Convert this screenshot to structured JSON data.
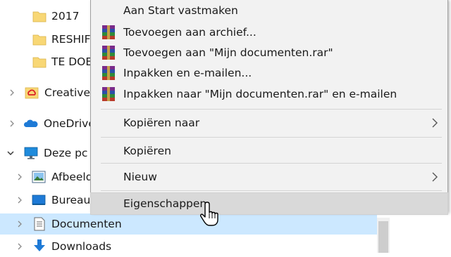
{
  "nav_pane": {
    "items": [
      {
        "label": "2017",
        "icon": "folder-icon"
      },
      {
        "label": "RESHIFT",
        "icon": "folder-icon"
      },
      {
        "label": "TE DOE",
        "icon": "folder-icon"
      },
      {
        "label": "Creative Cloud Files",
        "icon": "creative-cloud-icon"
      },
      {
        "label": "OneDrive",
        "icon": "onedrive-cloud-icon"
      },
      {
        "label": "Deze pc",
        "icon": "computer-icon"
      },
      {
        "label": "Afbeeldingen",
        "icon": "pictures-icon"
      },
      {
        "label": "Bureaublad",
        "icon": "desktop-icon"
      },
      {
        "label": "Documenten",
        "icon": "documents-icon",
        "selected": true
      },
      {
        "label": "Downloads",
        "icon": "download-arrow-icon"
      }
    ]
  },
  "context_menu": {
    "items": [
      {
        "label": "Aan Start vastmaken",
        "icon": null
      },
      {
        "label": "Toevoegen aan archief...",
        "icon": "winrar-icon"
      },
      {
        "label": "Toevoegen aan \"Mijn documenten.rar\"",
        "icon": "winrar-icon"
      },
      {
        "label": "Inpakken en e-mailen...",
        "icon": "winrar-icon"
      },
      {
        "label": "Inpakken naar \"Mijn documenten.rar\" en e-mailen",
        "icon": "winrar-icon"
      },
      {
        "label": "Kopiëren naar",
        "submenu": true
      },
      {
        "label": "Kopiëren"
      },
      {
        "label": "Nieuw",
        "submenu": true
      },
      {
        "label": "Eigenschappen",
        "highlighted": true
      }
    ]
  },
  "colors": {
    "selection": "#cce8ff",
    "menu_bg": "#f2f2f2",
    "menu_highlight": "#d9d9d9",
    "folder": "#f8d775",
    "accent_blue": "#1e7ad6"
  }
}
